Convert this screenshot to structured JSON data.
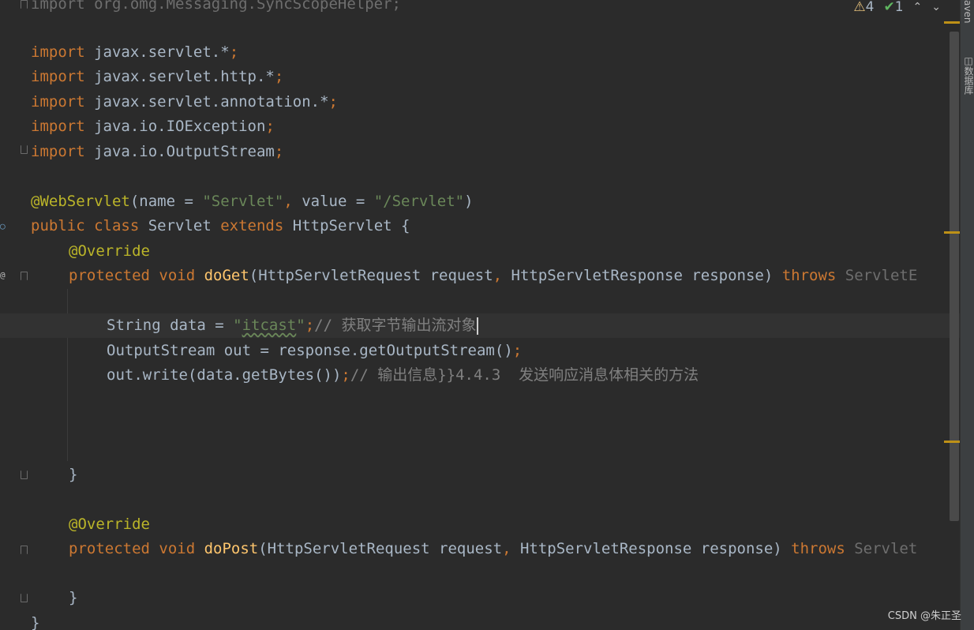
{
  "editor": {
    "line_top_partial": "import org.omg.Messaging.SyncScopeHelper;",
    "imports": [
      {
        "kw": "import",
        "path": "javax.servlet.*",
        "semi": ";"
      },
      {
        "kw": "import",
        "path": "javax.servlet.http.*",
        "semi": ";"
      },
      {
        "kw": "import",
        "path": "javax.servlet.annotation.*",
        "semi": ";"
      },
      {
        "kw": "import",
        "path": "java.io.IOException",
        "semi": ";"
      },
      {
        "kw": "import",
        "path": "java.io.OutputStream",
        "semi": ";"
      }
    ],
    "annotation_line": {
      "ann": "@WebServlet",
      "p1": "(name = ",
      "s1": "\"Servlet\"",
      "comma": ",",
      "p2": " value = ",
      "s2": "\"/Servlet\"",
      "p3": ")"
    },
    "class_line": {
      "kw1": "public class ",
      "name": "Servlet ",
      "kw2": "extends ",
      "parent": "HttpServlet {"
    },
    "override1": "@Override",
    "doget_line": {
      "kw": "protected void ",
      "meth": "doGet",
      "params": "(HttpServletRequest request",
      "comma": ",",
      "params2": " HttpServletResponse response) ",
      "throws": "throws ",
      "exc": "ServletE"
    },
    "line_data": {
      "decl": "String data = ",
      "str_q1": "\"",
      "str_val": "itcast",
      "str_q2": "\"",
      "semi": ";",
      "comment": "// 获取字节输出流对象"
    },
    "line_out": {
      "code": "OutputStream out = response.getOutputStream()",
      "semi": ";"
    },
    "line_write": {
      "code": "out.write(data.getBytes())",
      "semi": ";",
      "comment": "// 输出信息}}",
      "tail_num": "4.4.3",
      "tail_text": "  发送响应消息体相关的方法"
    },
    "close_brace_1": "}",
    "override2": "@Override",
    "dopost_line": {
      "kw": "protected void ",
      "meth": "doPost",
      "params": "(HttpServletRequest request",
      "comma": ",",
      "params2": " HttpServletResponse response) ",
      "throws": "throws ",
      "exc": "Servlet"
    },
    "close_brace_2": "}",
    "close_brace_3": "}"
  },
  "inspection": {
    "warnings": "4",
    "ok_count": "1"
  },
  "toolstrip": {
    "maven_label": "aven",
    "database_label": "数据库"
  },
  "watermark": "CSDN @朱正圣",
  "colors": {
    "background": "#2b2b2b",
    "keyword": "#cc7832",
    "string": "#6a8759",
    "annotation": "#bbb529",
    "method": "#ffc66d",
    "comment": "#808080",
    "text": "#a9b7c6",
    "marker": "#be9117"
  }
}
